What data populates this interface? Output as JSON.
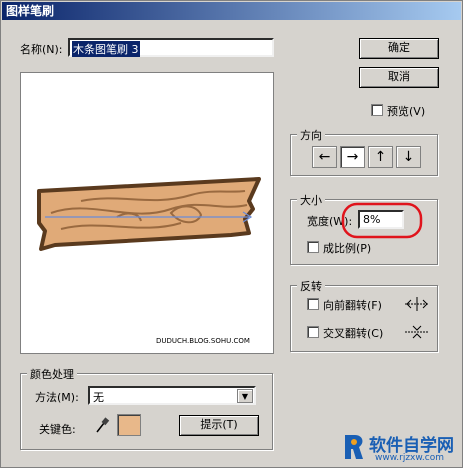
{
  "window": {
    "title": "图样笔刷"
  },
  "name_field": {
    "label": "名称(N):",
    "value": "木条图笔刷 3"
  },
  "buttons": {
    "ok": "确定",
    "cancel": "取消",
    "hint": "提示(T)"
  },
  "preview_toggle": {
    "label": "预览(V)",
    "checked": false
  },
  "preview_panel": {
    "caption": "DUDUCH.BLOG.SOHU.COM"
  },
  "direction": {
    "title": "方向",
    "arrows": [
      {
        "glyph": "←",
        "pressed": false
      },
      {
        "glyph": "→",
        "pressed": true
      },
      {
        "glyph": "↑",
        "pressed": false
      },
      {
        "glyph": "↓",
        "pressed": false
      }
    ]
  },
  "size": {
    "title": "大小",
    "width_label": "宽度(W):",
    "width_value": "8%",
    "proportional_label": "成比例(P)",
    "proportional_checked": false
  },
  "flip": {
    "title": "反转",
    "flip_along": {
      "label": "向前翻转(F)",
      "checked": false
    },
    "flip_across": {
      "label": "交叉翻转(C)",
      "checked": false
    }
  },
  "color": {
    "title": "颜色处理",
    "method_label": "方法(M):",
    "method_value": "无",
    "key_color_label": "关键色:",
    "key_color": "#e8b88a"
  },
  "colors": {
    "title_start": "#0a246a",
    "title_end": "#a6caf0",
    "highlight_circle": "#e0141c",
    "wood_fill": "#e0aa78",
    "wood_outline": "#5a3a1e",
    "guide_line": "#6a8cd8"
  },
  "watermark": {
    "logo_text": "软件自学网",
    "url": "www.rjzxw.com"
  }
}
